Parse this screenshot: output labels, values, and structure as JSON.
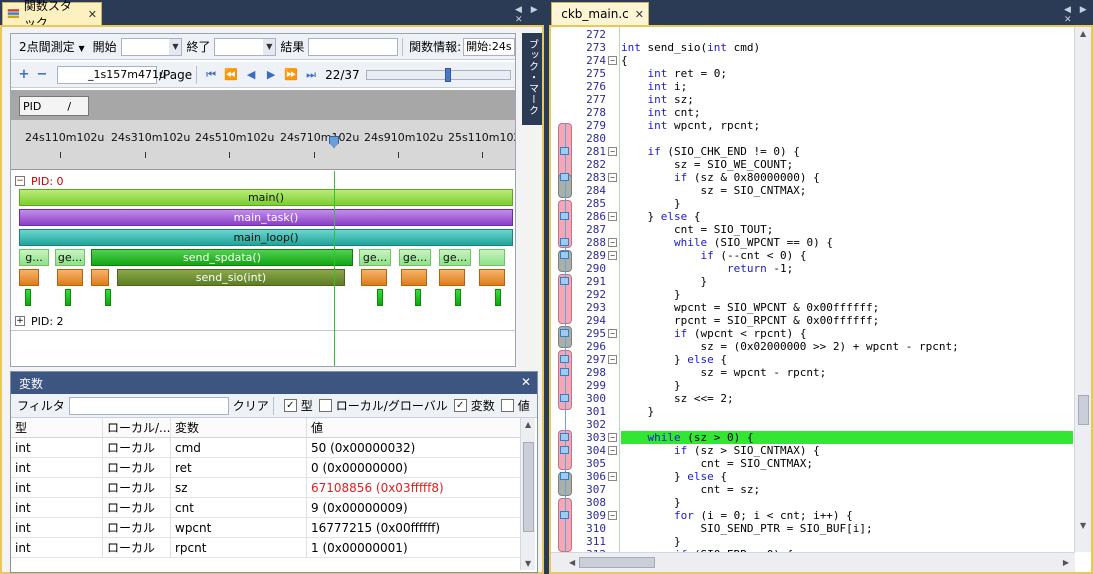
{
  "left_tab": {
    "title": "関数スタック",
    "close": "✕"
  },
  "right_tab": {
    "title": "ckb_main.c",
    "close": "✕"
  },
  "strip_arrows": "◀ ▶ ✕",
  "toolbar": {
    "mode_label": "2点間測定",
    "start_label": "開始",
    "end_label": "終了",
    "result_label": "結果",
    "info_label": "関数情報:",
    "info_value": "開始:24s",
    "plus": "+",
    "minus": "−",
    "page_value": "_1s157m471u",
    "page_suffix": "/Page",
    "page_count": "22/37",
    "slider_position": 0.58
  },
  "side_marker_label": "ブック・マーク",
  "pid_button": {
    "label": "PID",
    "slash": "/"
  },
  "ruler": {
    "labels": [
      "24s110m102u",
      "24s310m102u",
      "24s510m102u",
      "24s710m102u",
      "24s910m102u",
      "25s110m102u"
    ]
  },
  "lanes": {
    "pid0": {
      "expander": "−",
      "label": "PID: 0"
    },
    "pid2": {
      "expander": "+",
      "label": "PID: 2"
    },
    "main": "main()",
    "main_task": "main_task()",
    "main_loop": "main_loop()",
    "send_spdata": "send_spdata()",
    "send_sio": "send_sio(int)",
    "short_g": "g...",
    "short_ge": "ge..."
  },
  "variables": {
    "title": "変数",
    "close": "✕",
    "filter_label": "フィルタ",
    "clear_label": "クリア",
    "chk_type": "型",
    "chk_local_global": "ローカル/グローバル",
    "chk_var": "変数",
    "chk_value": "値",
    "checked_mark": "✓",
    "headers": [
      "型",
      "ローカル/...",
      "変数",
      "値"
    ],
    "rows": [
      {
        "type": "int",
        "scope": "ローカル",
        "name": "cmd",
        "value": "50 (0x00000032)",
        "color": "#000000"
      },
      {
        "type": "int",
        "scope": "ローカル",
        "name": "ret",
        "value": "0 (0x00000000)",
        "color": "#000000"
      },
      {
        "type": "int",
        "scope": "ローカル",
        "name": "sz",
        "value": "67108856 (0x03fffff8)",
        "color": "#e02020"
      },
      {
        "type": "int",
        "scope": "ローカル",
        "name": "cnt",
        "value": "9 (0x00000009)",
        "color": "#000000"
      },
      {
        "type": "int",
        "scope": "ローカル",
        "name": "wpcnt",
        "value": "16777215 (0x00ffffff)",
        "color": "#000000"
      },
      {
        "type": "int",
        "scope": "ローカル",
        "name": "rpcnt",
        "value": "1 (0x00000001)",
        "color": "#000000"
      }
    ]
  },
  "code": {
    "highlight_line": 303,
    "lines": [
      {
        "n": "272",
        "t": ""
      },
      {
        "n": "273",
        "t": "int send_sio(int cmd)"
      },
      {
        "n": "274",
        "t": "{",
        "fold": "−"
      },
      {
        "n": "275",
        "t": "    int ret = 0;"
      },
      {
        "n": "276",
        "t": "    int i;"
      },
      {
        "n": "277",
        "t": "    int sz;"
      },
      {
        "n": "278",
        "t": "    int cnt;"
      },
      {
        "n": "279",
        "t": "    int wpcnt, rpcnt;"
      },
      {
        "n": "280",
        "t": ""
      },
      {
        "n": "281",
        "t": "    if (SIO_CHK_END != 0) {",
        "fold": "−"
      },
      {
        "n": "282",
        "t": "        sz = SIO_WE_COUNT;"
      },
      {
        "n": "283",
        "t": "        if (sz & 0x80000000) {",
        "fold": "−"
      },
      {
        "n": "284",
        "t": "            sz = SIO_CNTMAX;"
      },
      {
        "n": "285",
        "t": "        }"
      },
      {
        "n": "286",
        "t": "    } else {",
        "fold": "−"
      },
      {
        "n": "287",
        "t": "        cnt = SIO_TOUT;"
      },
      {
        "n": "288",
        "t": "        while (SIO_WPCNT == 0) {",
        "fold": "−"
      },
      {
        "n": "289",
        "t": "            if (--cnt < 0) {",
        "fold": "−"
      },
      {
        "n": "290",
        "t": "                return -1;"
      },
      {
        "n": "291",
        "t": "            }"
      },
      {
        "n": "292",
        "t": "        }"
      },
      {
        "n": "293",
        "t": "        wpcnt = SIO_WPCNT & 0x00ffffff;"
      },
      {
        "n": "294",
        "t": "        rpcnt = SIO_RPCNT & 0x00ffffff;"
      },
      {
        "n": "295",
        "t": "        if (wpcnt < rpcnt) {",
        "fold": "−"
      },
      {
        "n": "296",
        "t": "            sz = (0x02000000 >> 2) + wpcnt - rpcnt;"
      },
      {
        "n": "297",
        "t": "        } else {",
        "fold": "−"
      },
      {
        "n": "298",
        "t": "            sz = wpcnt - rpcnt;"
      },
      {
        "n": "299",
        "t": "        }"
      },
      {
        "n": "300",
        "t": "        sz <<= 2;"
      },
      {
        "n": "301",
        "t": "    }"
      },
      {
        "n": "302",
        "t": ""
      },
      {
        "n": "303",
        "t": "    while (sz > 0) {",
        "fold": "−"
      },
      {
        "n": "304",
        "t": "        if (sz > SIO_CNTMAX) {",
        "fold": "−"
      },
      {
        "n": "305",
        "t": "            cnt = SIO_CNTMAX;"
      },
      {
        "n": "306",
        "t": "        } else {",
        "fold": "−"
      },
      {
        "n": "307",
        "t": "            cnt = sz;"
      },
      {
        "n": "308",
        "t": "        }"
      },
      {
        "n": "309",
        "t": "        for (i = 0; i < cnt; i++) {",
        "fold": "−"
      },
      {
        "n": "310",
        "t": "            SIO_SEND_PTR = SIO_BUF[i];"
      },
      {
        "n": "311",
        "t": "        }"
      },
      {
        "n": "312",
        "t": "        if (SIO_ERR < 0) {"
      }
    ]
  }
}
